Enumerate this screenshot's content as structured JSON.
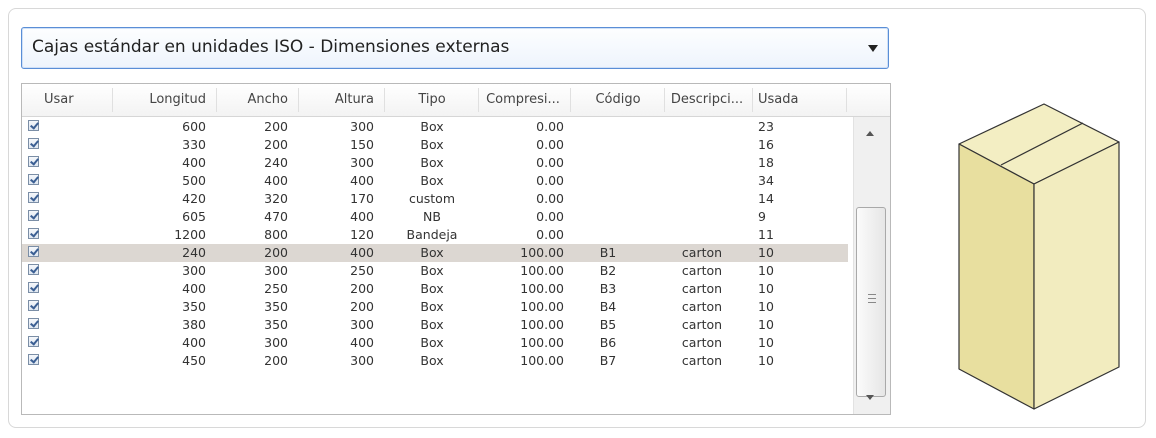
{
  "dropdown": {
    "selected": "Cajas estándar en unidades ISO - Dimensiones externas"
  },
  "table": {
    "columns": [
      "Usar",
      "Longitud",
      "Ancho",
      "Altura",
      "Tipo",
      "Compresi...",
      "Código",
      "Descripci...",
      "Usada"
    ],
    "rows": [
      {
        "checked": true,
        "longitud": "600",
        "ancho": "200",
        "altura": "300",
        "tipo": "Box",
        "compresion": "0.00",
        "codigo": "",
        "descripcion": "",
        "usada": "23"
      },
      {
        "checked": true,
        "longitud": "330",
        "ancho": "200",
        "altura": "150",
        "tipo": "Box",
        "compresion": "0.00",
        "codigo": "",
        "descripcion": "",
        "usada": "16"
      },
      {
        "checked": true,
        "longitud": "400",
        "ancho": "240",
        "altura": "300",
        "tipo": "Box",
        "compresion": "0.00",
        "codigo": "",
        "descripcion": "",
        "usada": "18"
      },
      {
        "checked": true,
        "longitud": "500",
        "ancho": "400",
        "altura": "400",
        "tipo": "Box",
        "compresion": "0.00",
        "codigo": "",
        "descripcion": "",
        "usada": "34"
      },
      {
        "checked": true,
        "longitud": "420",
        "ancho": "320",
        "altura": "170",
        "tipo": "custom",
        "compresion": "0.00",
        "codigo": "",
        "descripcion": "",
        "usada": "14"
      },
      {
        "checked": true,
        "longitud": "605",
        "ancho": "470",
        "altura": "400",
        "tipo": "NB",
        "compresion": "0.00",
        "codigo": "",
        "descripcion": "",
        "usada": "9"
      },
      {
        "checked": true,
        "longitud": "1200",
        "ancho": "800",
        "altura": "120",
        "tipo": "Bandeja",
        "compresion": "0.00",
        "codigo": "",
        "descripcion": "",
        "usada": "11"
      },
      {
        "checked": true,
        "selected": true,
        "longitud": "240",
        "ancho": "200",
        "altura": "400",
        "tipo": "Box",
        "compresion": "100.00",
        "codigo": "B1",
        "descripcion": "carton",
        "usada": "10"
      },
      {
        "checked": true,
        "longitud": "300",
        "ancho": "300",
        "altura": "250",
        "tipo": "Box",
        "compresion": "100.00",
        "codigo": "B2",
        "descripcion": "carton",
        "usada": "10"
      },
      {
        "checked": true,
        "longitud": "400",
        "ancho": "250",
        "altura": "200",
        "tipo": "Box",
        "compresion": "100.00",
        "codigo": "B3",
        "descripcion": "carton",
        "usada": "10"
      },
      {
        "checked": true,
        "longitud": "350",
        "ancho": "350",
        "altura": "200",
        "tipo": "Box",
        "compresion": "100.00",
        "codigo": "B4",
        "descripcion": "carton",
        "usada": "10"
      },
      {
        "checked": true,
        "longitud": "380",
        "ancho": "350",
        "altura": "300",
        "tipo": "Box",
        "compresion": "100.00",
        "codigo": "B5",
        "descripcion": "carton",
        "usada": "10"
      },
      {
        "checked": true,
        "longitud": "400",
        "ancho": "300",
        "altura": "400",
        "tipo": "Box",
        "compresion": "100.00",
        "codigo": "B6",
        "descripcion": "carton",
        "usada": "10"
      },
      {
        "checked": true,
        "longitud": "450",
        "ancho": "200",
        "altura": "300",
        "tipo": "Box",
        "compresion": "100.00",
        "codigo": "B7",
        "descripcion": "carton",
        "usada": "10"
      }
    ]
  },
  "preview": {
    "icon": "box-3d-preview",
    "colors": {
      "top": "#f3eec3",
      "left": "#e8df9f",
      "right": "#f2ecbf",
      "edge": "#333333"
    }
  }
}
